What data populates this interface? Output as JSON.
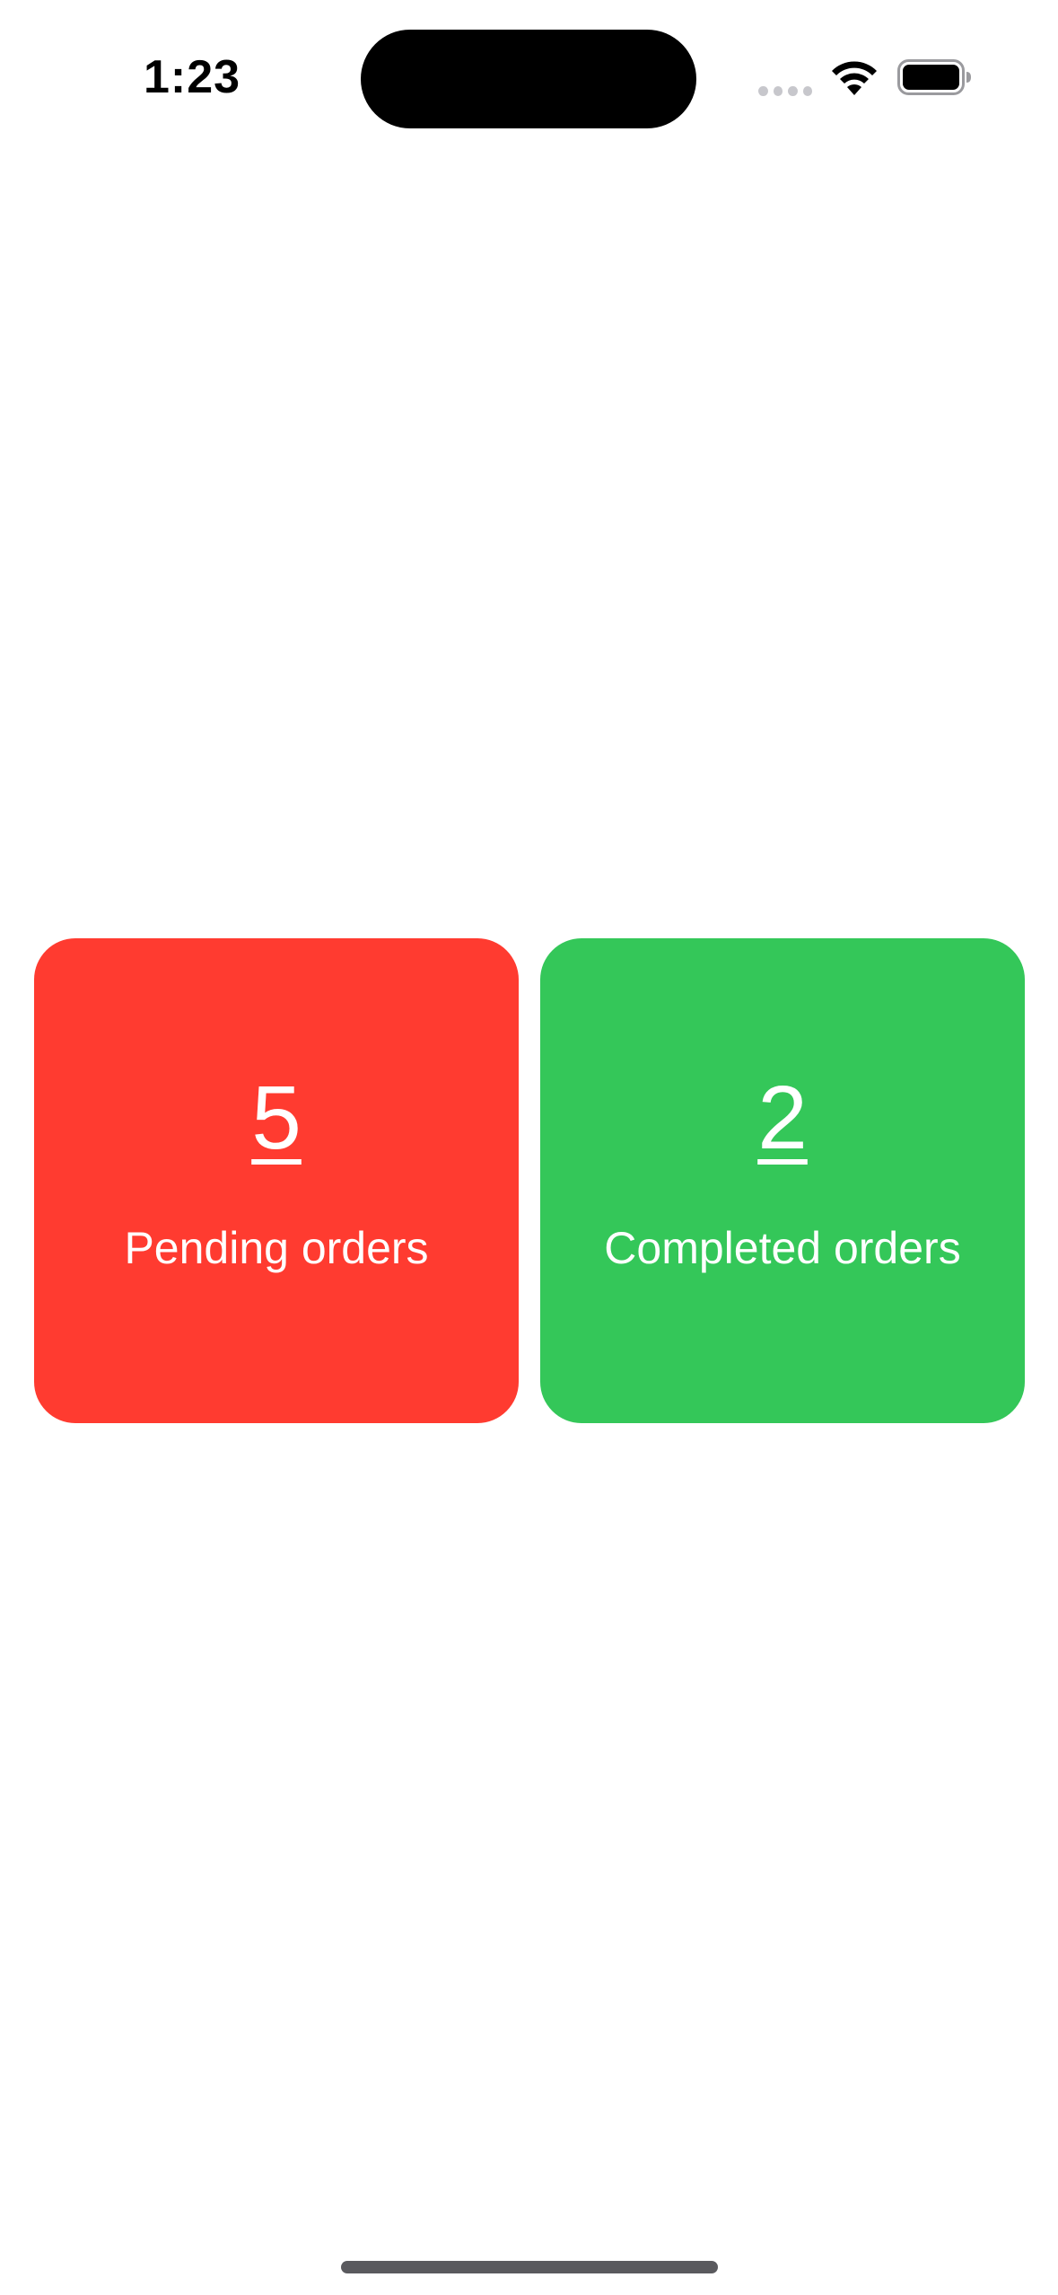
{
  "status_bar": {
    "time": "1:23",
    "icons": [
      "cellular-signal-icon",
      "wifi-icon",
      "battery-icon"
    ]
  },
  "cards": {
    "pending": {
      "count": "5",
      "label": "Pending orders",
      "color": "#ff3b30"
    },
    "completed": {
      "count": "2",
      "label": "Completed orders",
      "color": "#34c759"
    }
  }
}
